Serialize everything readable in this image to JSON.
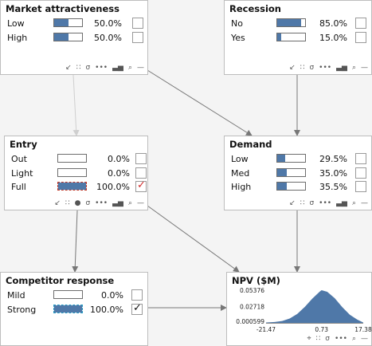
{
  "nodes": {
    "market": {
      "title": "Market attractiveness",
      "states": [
        {
          "label": "Low",
          "pct": "50.0%",
          "value": 0.5,
          "checked": false,
          "evidence": false
        },
        {
          "label": "High",
          "pct": "50.0%",
          "value": 0.5,
          "checked": false,
          "evidence": false
        }
      ]
    },
    "recession": {
      "title": "Recession",
      "states": [
        {
          "label": "No",
          "pct": "85.0%",
          "value": 0.85,
          "checked": false,
          "evidence": false
        },
        {
          "label": "Yes",
          "pct": "15.0%",
          "value": 0.15,
          "checked": false,
          "evidence": false
        }
      ]
    },
    "entry": {
      "title": "Entry",
      "states": [
        {
          "label": "Out",
          "pct": "0.0%",
          "value": 0.0,
          "checked": false,
          "evidence": false
        },
        {
          "label": "Light",
          "pct": "0.0%",
          "value": 0.0,
          "checked": false,
          "evidence": false
        },
        {
          "label": "Full",
          "pct": "100.0%",
          "value": 1.0,
          "checked": true,
          "evidence": true,
          "check_color": "#d12a2a",
          "border_color": "#c0392b"
        }
      ]
    },
    "demand": {
      "title": "Demand",
      "states": [
        {
          "label": "Low",
          "pct": "29.5%",
          "value": 0.295,
          "checked": false,
          "evidence": false
        },
        {
          "label": "Med",
          "pct": "35.0%",
          "value": 0.35,
          "checked": false,
          "evidence": false
        },
        {
          "label": "High",
          "pct": "35.5%",
          "value": 0.355,
          "checked": false,
          "evidence": false
        }
      ]
    },
    "competitor": {
      "title": "Competitor response",
      "states": [
        {
          "label": "Mild",
          "pct": "0.0%",
          "value": 0.0,
          "checked": false,
          "evidence": false
        },
        {
          "label": "Strong",
          "pct": "100.0%",
          "value": 1.0,
          "checked": true,
          "evidence": true,
          "check_color": "#111111",
          "border_color": "#2a9bc4"
        }
      ]
    },
    "npv": {
      "title": "NPV ($M)",
      "y_ticks": [
        "0.05376",
        "0.02718",
        "0.000599"
      ],
      "x_ticks": [
        "-21.47",
        "0.73",
        "17.38"
      ]
    }
  },
  "chart_data": {
    "type": "area",
    "title": "NPV ($M)",
    "x_ticks": [
      -21.47,
      0.73,
      17.38
    ],
    "y_ticks": [
      0.05376,
      0.02718,
      0.000599
    ],
    "x": [
      -21.47,
      -18,
      -15,
      -12,
      -9,
      -6,
      -3,
      0,
      0.73,
      3,
      6,
      9,
      12,
      15,
      17.38
    ],
    "y": [
      0.0006,
      0.0014,
      0.0032,
      0.0072,
      0.0148,
      0.0262,
      0.0398,
      0.0515,
      0.0538,
      0.0512,
      0.0405,
      0.0258,
      0.0134,
      0.0054,
      0.0006
    ],
    "color": "#4f78a8"
  },
  "colors": {
    "bar": "#4f78a8",
    "arrow": "#777777",
    "arrow_faint": "#cfcfcf"
  },
  "toolbar_icons": [
    "arrow-in-icon",
    "grid-icon",
    "sigma-icon",
    "dots-icon",
    "histogram-icon",
    "search-icon",
    "minus-icon"
  ],
  "entry_toolbar_icons": [
    "arrow-in-icon",
    "grid-icon",
    "dot-icon",
    "sigma-icon",
    "dots-icon",
    "histogram-icon",
    "search-icon",
    "minus-icon"
  ],
  "npv_toolbar_icons": [
    "pin-icon",
    "grid-icon",
    "sigma-icon",
    "dots-icon",
    "search-icon",
    "minus-icon"
  ]
}
